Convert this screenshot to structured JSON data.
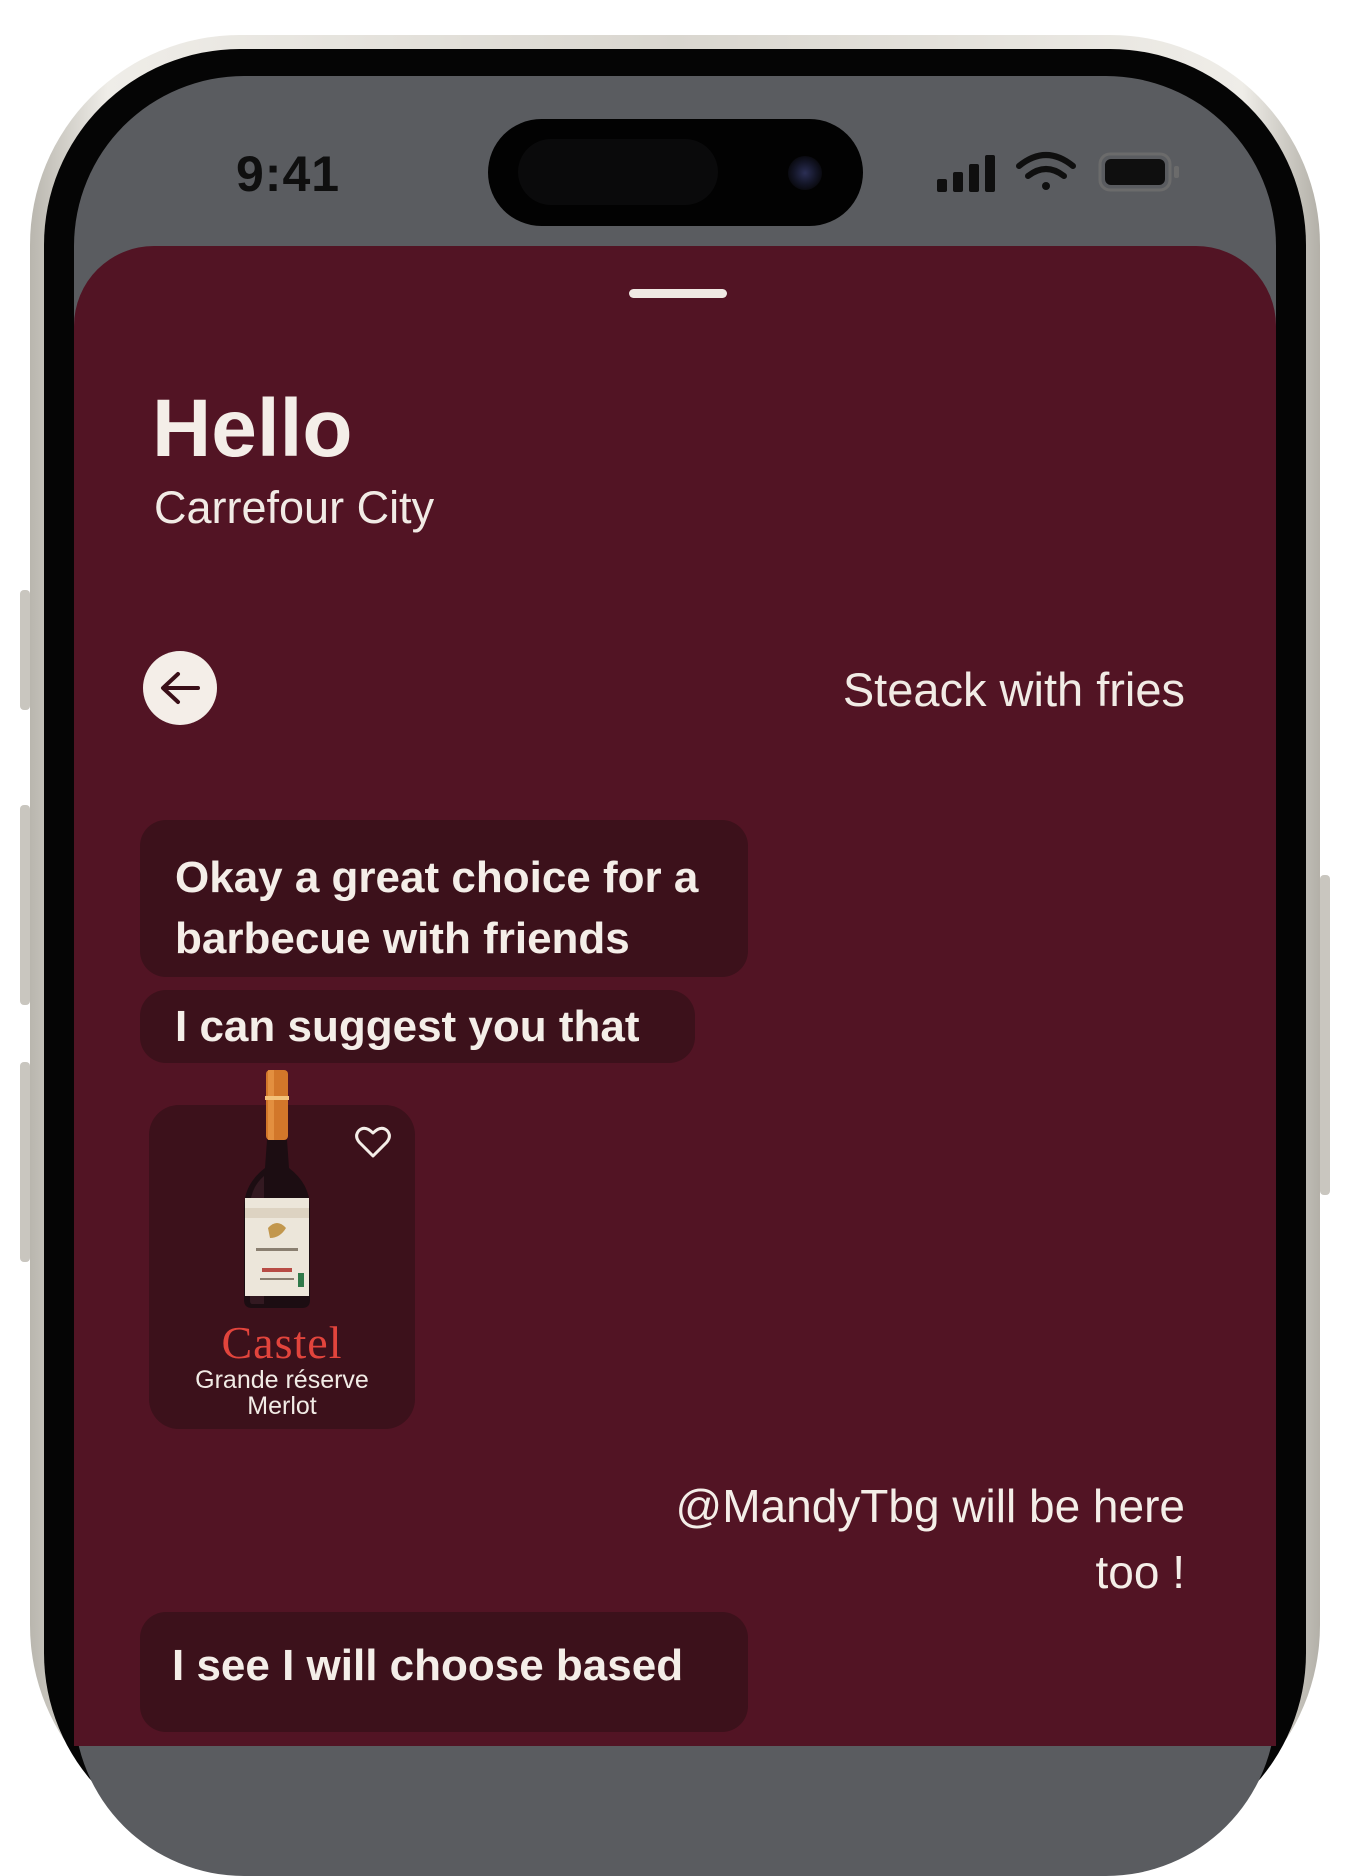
{
  "status_bar": {
    "time": "9:41",
    "icons": [
      "cellular-signal-icon",
      "wifi-icon",
      "battery-icon"
    ]
  },
  "header": {
    "title": "Hello",
    "subtitle": "Carrefour City"
  },
  "conversation": {
    "topic": "Steack with fries",
    "messages": [
      {
        "from": "assistant",
        "text": "Okay a great choice for a barbecue with friends"
      },
      {
        "from": "assistant",
        "text": "I can suggest you that"
      },
      {
        "from": "user",
        "text": "@MandyTbg will be here too !"
      },
      {
        "from": "assistant",
        "text": "I see I will choose based"
      }
    ]
  },
  "product": {
    "brand": "Castel",
    "name_line1": "Grande réserve",
    "name_line2": "Merlot"
  },
  "colors": {
    "sheet_background": "#521424",
    "bubble_background": "#3c111b",
    "text_light": "#f4eee8",
    "brand_red": "#e2443c"
  }
}
